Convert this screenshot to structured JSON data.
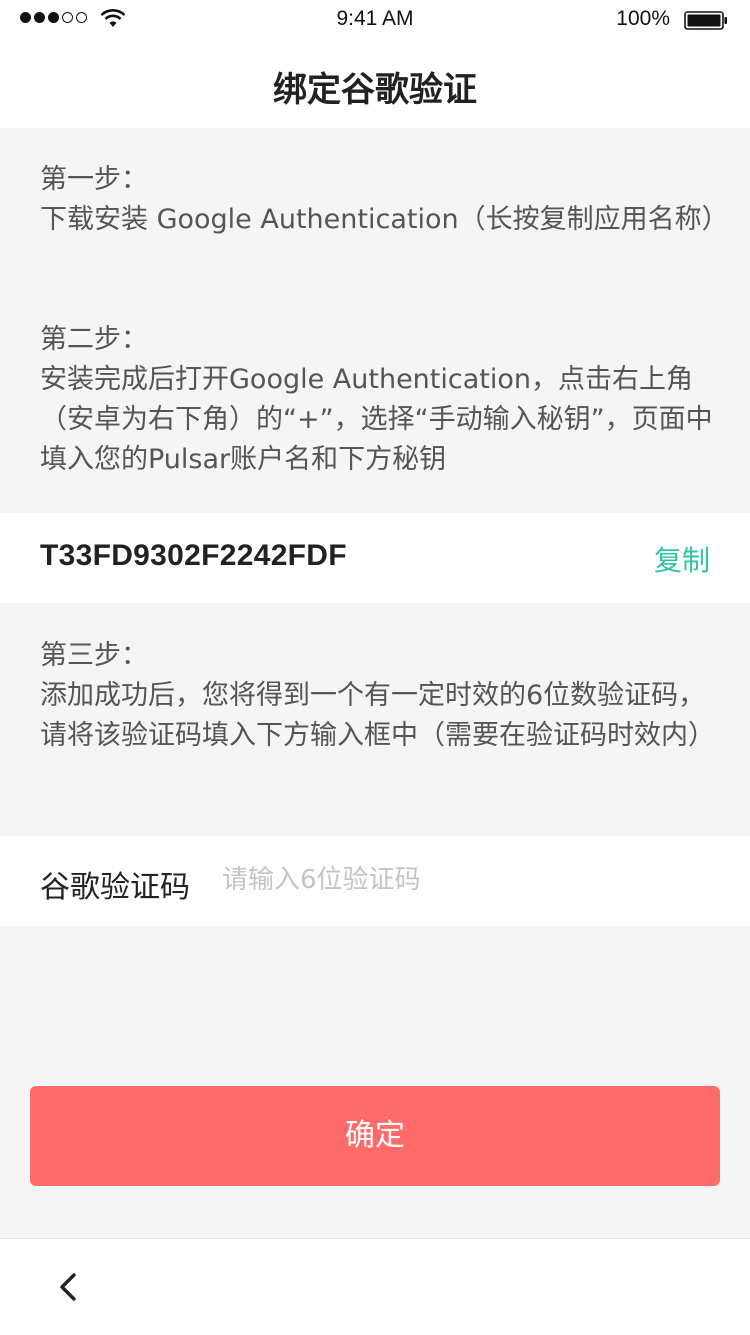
{
  "status_bar": {
    "time": "9:41 AM",
    "battery_percent": "100%",
    "signal_icon": "signal-dots-icon",
    "wifi_icon": "wifi-icon",
    "battery_icon": "battery-icon"
  },
  "header": {
    "title": "绑定谷歌验证"
  },
  "step1": {
    "title": "第一步：",
    "body": "下载安装  Google Authentication（长按复制应用名称）"
  },
  "step2": {
    "title": "第二步：",
    "body": "安装完成后打开Google Authentication，点击右上角（安卓为右下角）的“+”，选择“手动输入秘钥”，页面中填入您的Pulsar账户名和下方秘钥"
  },
  "secret": {
    "key": "T33FD9302F2242FDF",
    "copy_label": "复制"
  },
  "step3": {
    "title": "第三步：",
    "body": "添加成功后，您将得到一个有一定时效的6位数验证码，请将该验证码填入下方输入框中（需要在验证码时效内）"
  },
  "verify": {
    "label": "谷歌验证码",
    "placeholder": "请输入6位验证码",
    "value": ""
  },
  "confirm": {
    "label": "确定"
  },
  "footer": {
    "back_icon": "chevron-left-icon"
  },
  "colors": {
    "accent": "#2ec4a0",
    "confirm_button": "#ff6b6b",
    "background": "#f5f5f5"
  }
}
